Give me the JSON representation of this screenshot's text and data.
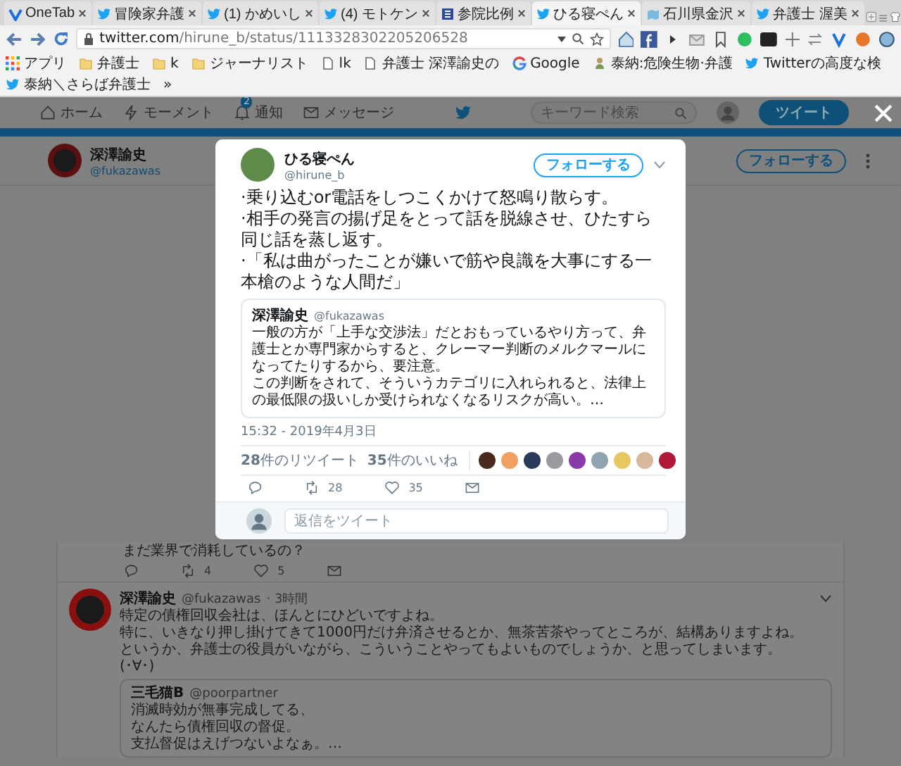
{
  "tabs": [
    {
      "title": "OneTab",
      "kind": "onetab",
      "selected": false
    },
    {
      "title": "冒険家弁護",
      "kind": "bird",
      "selected": false
    },
    {
      "title": "(1) かめいし",
      "kind": "bird",
      "selected": false
    },
    {
      "title": "(4) モトケン",
      "kind": "bird",
      "selected": false
    },
    {
      "title": "参院比例",
      "kind": "site",
      "selected": false
    },
    {
      "title": "ひる寝ぺん",
      "kind": "bird",
      "selected": true
    },
    {
      "title": "石川県金沢",
      "kind": "map",
      "selected": false
    },
    {
      "title": "弁護士 渥美",
      "kind": "bird",
      "selected": false
    }
  ],
  "toolbar": {
    "url_host": "twitter.com",
    "url_path": "/hirune_b/status/1113328302205206528"
  },
  "bookmarks": [
    {
      "label": "アプリ",
      "kind": "apps"
    },
    {
      "label": "弁護士",
      "kind": "folder"
    },
    {
      "label": "k",
      "kind": "folder"
    },
    {
      "label": "ジャーナリスト",
      "kind": "folder"
    },
    {
      "label": "lk",
      "kind": "page"
    },
    {
      "label": "弁護士 深澤諭史の",
      "kind": "page"
    },
    {
      "label": "Google",
      "kind": "google"
    },
    {
      "label": "泰納:危険生物·弁護",
      "kind": "person"
    },
    {
      "label": "Twitterの高度な検",
      "kind": "bird"
    },
    {
      "label": "泰納＼さらば弁護士",
      "kind": "bird"
    }
  ],
  "bookmarks_more": "»",
  "nav": {
    "items": [
      {
        "label": "ホーム",
        "kind": "home"
      },
      {
        "label": "モーメント",
        "kind": "bolt"
      },
      {
        "label": "通知",
        "kind": "bell",
        "badge": "2"
      },
      {
        "label": "メッセージ",
        "kind": "mail"
      }
    ],
    "search_placeholder": "キーワード検索",
    "tweet_button": "ツイート"
  },
  "profile": {
    "name": "深澤諭史",
    "handle": "@fukazawas",
    "follow": "フォローする"
  },
  "modal": {
    "name": "ひる寝ぺん",
    "handle": "@hirune_b",
    "follow": "フォローする",
    "text": [
      "·乗り込むor電話をしつこくかけて怒鳴り散らす。",
      "·相手の発言の揚げ足をとって話を脱線させ、ひたすら同じ話を蒸し返す。",
      "·「私は曲がったことが嫌いで筋や良識を大事にする一本槍のような人間だ」"
    ],
    "quote": {
      "name": "深澤諭史",
      "handle": "@fukazawas",
      "text": [
        "一般の方が「上手な交渉法」だとおもっているやり方って、弁護士とか専門家からすると、クレーマー判断のメルクマールになってたりするから、要注意。",
        "この判断をされて、そういうカテゴリに入れられると、法律上の最低限の扱いしか受けられなくなるリスクが高い。…"
      ]
    },
    "time": "15:32 - 2019年4月3日",
    "retweet_stat": "**28**件のリツイート",
    "like_stat": "**35**件のいいね",
    "likers": [
      {
        "color": "#4a2a1c"
      },
      {
        "color": "#f0a060"
      },
      {
        "color": "#2a3a5a"
      },
      {
        "color": "#9a9aa0"
      },
      {
        "color": "#8a3aa8"
      },
      {
        "color": "#8ea4b0"
      },
      {
        "color": "#e8c860"
      },
      {
        "color": "#d8b89a"
      },
      {
        "color": "#b01838"
      }
    ],
    "retweet_count": "28",
    "like_count": "35",
    "reply_placeholder": "返信をツイート"
  },
  "timeline": {
    "partial_text": "まだ業界で消耗しているの？",
    "retweet_count": "4",
    "like_count": "5",
    "tweet": {
      "name": "深澤諭史",
      "handle": "@fukazawas",
      "time": "· 3時間",
      "text": [
        "特定の債権回収会社は、ほんとにひどいですよね。",
        "特に、いきなり押し掛けてきて1000円だけ弁済させるとか、無茶苦茶やってところが、結構ありますよね。",
        "というか、弁護士の役員がいながら、こういうことやってもよいものでしょうか、と思ってしまいます。",
        "(･∀･)"
      ],
      "quote": {
        "name": "三毛猫B",
        "handle": "@poorpartner",
        "text": [
          "消滅時効が無事完成してる、",
          "なんたら債権回収の督促。",
          "支払督促はえげつないよなぁ。…"
        ]
      }
    }
  }
}
